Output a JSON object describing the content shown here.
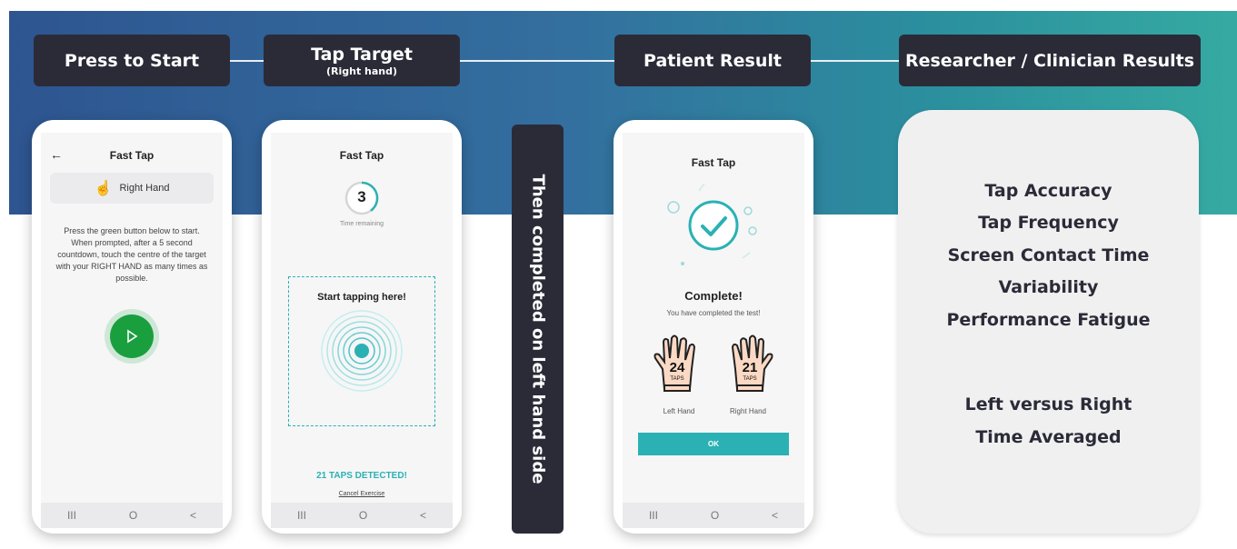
{
  "headers": {
    "press_start": "Press to Start",
    "tap_target": "Tap Target",
    "tap_target_sub": "(Right hand)",
    "patient_result": "Patient Result",
    "researcher": "Researcher / Clinician Results"
  },
  "vertical_label": "Then completed on left hand side",
  "phone1": {
    "title": "Fast Tap",
    "hand_label": "Right Hand",
    "instructions": "Press the green button below to start. When prompted, after a 5 second countdown, touch the centre of the target with your RIGHT HAND as many times as possible."
  },
  "phone2": {
    "title": "Fast Tap",
    "countdown": "3",
    "time_remaining": "Time remaining",
    "start_tapping": "Start tapping here!",
    "taps_detected": "21 TAPS DETECTED!",
    "cancel": "Cancel Exercise"
  },
  "phone3": {
    "title": "Fast Tap",
    "complete": "Complete!",
    "completed_text": "You have completed the test!",
    "left_taps": "24",
    "right_taps": "21",
    "taps_unit": "TAPS",
    "left_label": "Left Hand",
    "right_label": "Right Hand",
    "ok": "OK"
  },
  "navbar": {
    "recent": "III",
    "home": "O",
    "back": "<"
  },
  "results": {
    "items": [
      "Tap Accuracy",
      "Tap Frequency",
      "Screen Contact Time",
      "Variability",
      "Performance Fatigue"
    ],
    "extra": [
      "Left versus Right",
      "Time Averaged"
    ]
  },
  "colors": {
    "teal": "#2bb1b3",
    "green": "#1fa64a",
    "dark": "#2b2b38"
  }
}
